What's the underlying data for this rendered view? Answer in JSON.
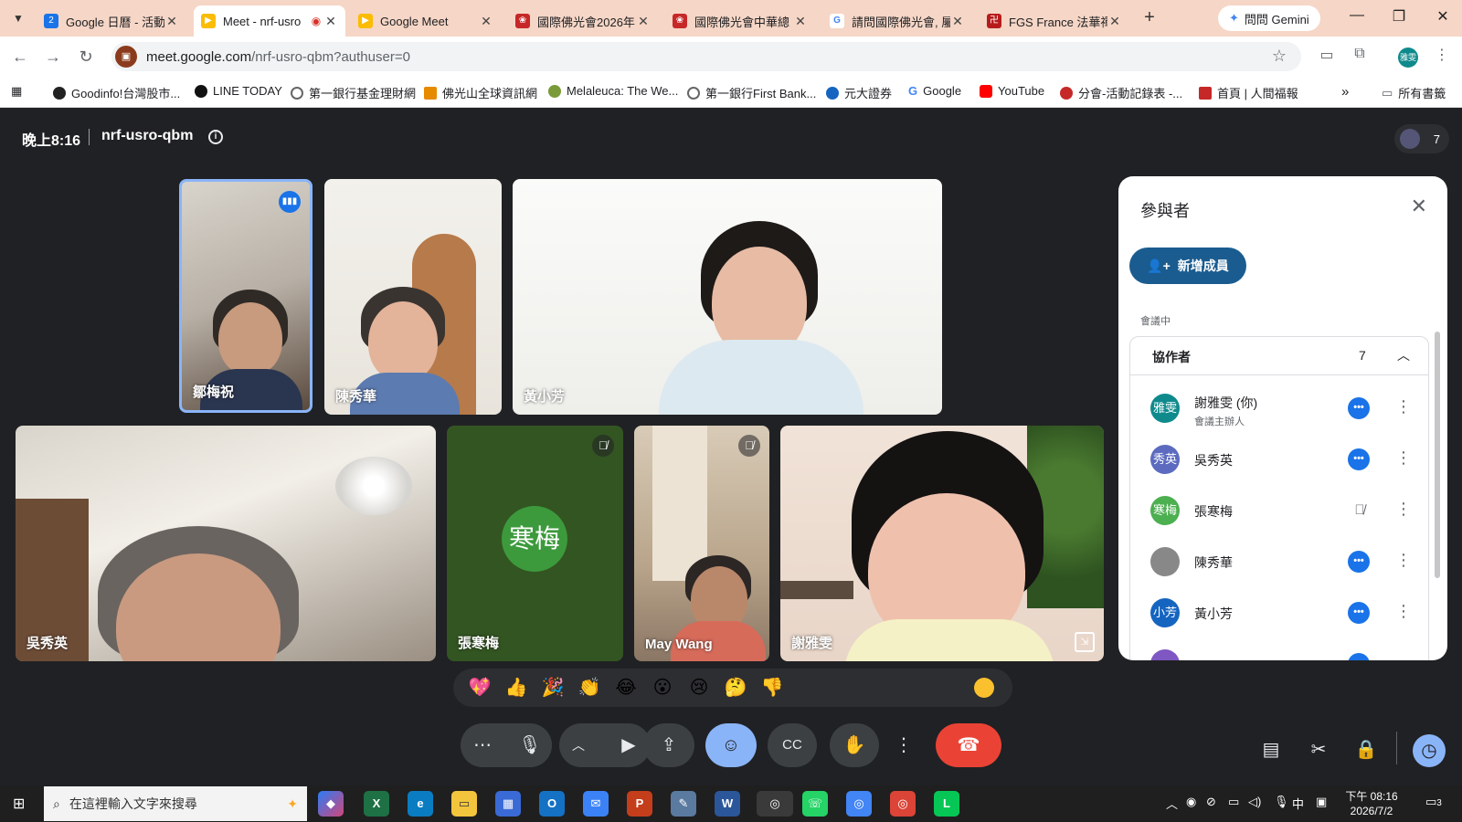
{
  "browser": {
    "tabs": [
      {
        "title": "Google 日曆 - 活動",
        "favicon": "calendar-icon",
        "active": false
      },
      {
        "title": "Meet - nrf-usro",
        "favicon": "meet-icon",
        "active": true
      },
      {
        "title": "Google Meet",
        "favicon": "meet-icon",
        "active": false
      },
      {
        "title": "國際佛光會2026年",
        "favicon": "blia-icon",
        "active": false
      },
      {
        "title": "國際佛光會中華總",
        "favicon": "blia-icon",
        "active": false
      },
      {
        "title": "請問國際佛光會, 屬",
        "favicon": "google-icon",
        "active": false
      },
      {
        "title": "FGS France 法華禪",
        "favicon": "fgs-icon",
        "active": false
      }
    ],
    "gemini_label": "問問 Gemini",
    "url_host": "meet.google.com",
    "url_path": "/nrf-usro-qbm?authuser=0",
    "bookmarks": [
      "Goodinfo!台灣股市...",
      "LINE TODAY",
      "第一銀行基金理財網",
      "佛光山全球資訊網",
      "Melaleuca: The We...",
      "第一銀行First Bank...",
      "元大證券",
      "Google",
      "YouTube",
      "分會-活動記錄表 -...",
      "首頁 | 人間福報"
    ],
    "all_bookmarks": "所有書籤"
  },
  "meet": {
    "time": "晚上8:16",
    "code": "nrf-usro-qbm",
    "participant_count": "7",
    "tiles": [
      {
        "name": "鄒梅祝",
        "speaking": true
      },
      {
        "name": "陳秀華"
      },
      {
        "name": "黃小芳"
      },
      {
        "name": "吳秀英"
      },
      {
        "name": "張寒梅",
        "avatar_text": "寒梅",
        "muted": true
      },
      {
        "name": "May Wang",
        "muted": true
      },
      {
        "name": "謝雅雯"
      }
    ],
    "reactions": [
      "💖",
      "👍",
      "🎉",
      "👏",
      "😂",
      "😮",
      "😢",
      "🤔",
      "👎"
    ]
  },
  "panel": {
    "title": "參與者",
    "add_label": "新增成員",
    "in_call_label": "會議中",
    "group_label": "協作者",
    "group_count": "7",
    "people": [
      {
        "avatar": "雅雯",
        "name": "謝雅雯 (你)",
        "sub": "會議主辦人",
        "color": "#0f8a8c",
        "muted": false
      },
      {
        "avatar": "秀英",
        "name": "吳秀英",
        "sub": "",
        "color": "#5c6bc0",
        "muted": false
      },
      {
        "avatar": "寒梅",
        "name": "張寒梅",
        "sub": "",
        "color": "#4caf50",
        "muted": true
      },
      {
        "avatar": "",
        "name": "陳秀華",
        "sub": "",
        "color": "#888888",
        "muted": false
      },
      {
        "avatar": "小芳",
        "name": "黃小芳",
        "sub": "",
        "color": "#1565c0",
        "muted": false
      }
    ]
  },
  "taskbar": {
    "search_placeholder": "在這裡輸入文字來搜尋",
    "time": "下午 08:16",
    "date": "2026/7/2",
    "ime": "中",
    "notifications": "3"
  }
}
